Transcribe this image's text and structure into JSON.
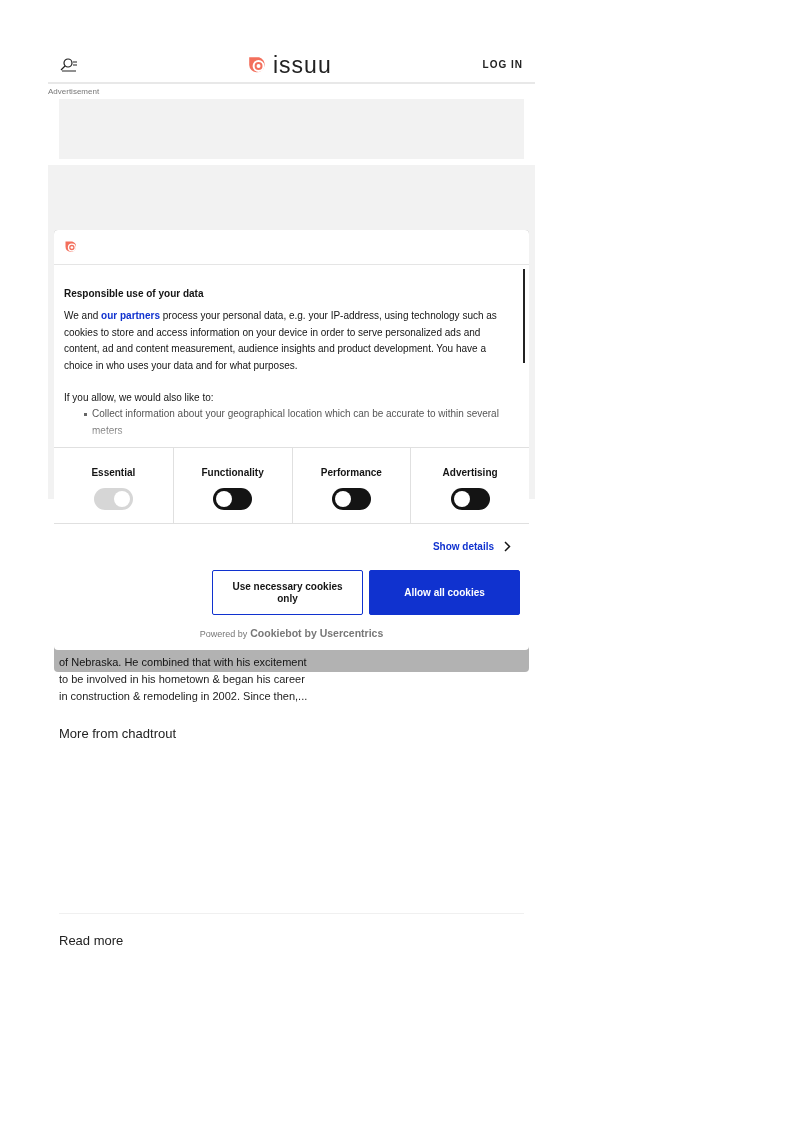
{
  "header": {
    "logo_text": "issuu",
    "login": "LOG IN"
  },
  "advertisement_label": "Advertisement",
  "description_lines": [
    "of Nebraska. He combined that with his excitement",
    "to be involved in his hometown & began his career",
    "in construction & remodeling in 2002. Since then,..."
  ],
  "more_from": "More from chadtrout",
  "read_more": "Read more",
  "consent": {
    "title": "Responsible use of your data",
    "body_before": "We and",
    "link": "our partners",
    "body_after": "process your personal data, e.g. your IP-address, using technology such as cookies to store and access information on your device in order to serve personalized ads and content, ad and content measurement, audience insights and product development. You have a choice in who uses your data and for what purposes.",
    "intro": "If you allow, we would also like to:",
    "bullets": [
      "Collect information about your geographical location which can be accurate to within several meters"
    ],
    "categories": [
      {
        "label": "Essential",
        "on": true,
        "disabled": true
      },
      {
        "label": "Functionality",
        "on": false,
        "disabled": false
      },
      {
        "label": "Performance",
        "on": false,
        "disabled": false
      },
      {
        "label": "Advertising",
        "on": false,
        "disabled": false
      }
    ],
    "show_details": "Show details",
    "buttons": [
      {
        "label": "Use necessary cookies only",
        "kind": "outline"
      },
      {
        "label": "Allow all cookies",
        "kind": "primary"
      }
    ],
    "powered_by": "Powered by",
    "powered_brand": "Cookiebot by Usercentrics"
  }
}
